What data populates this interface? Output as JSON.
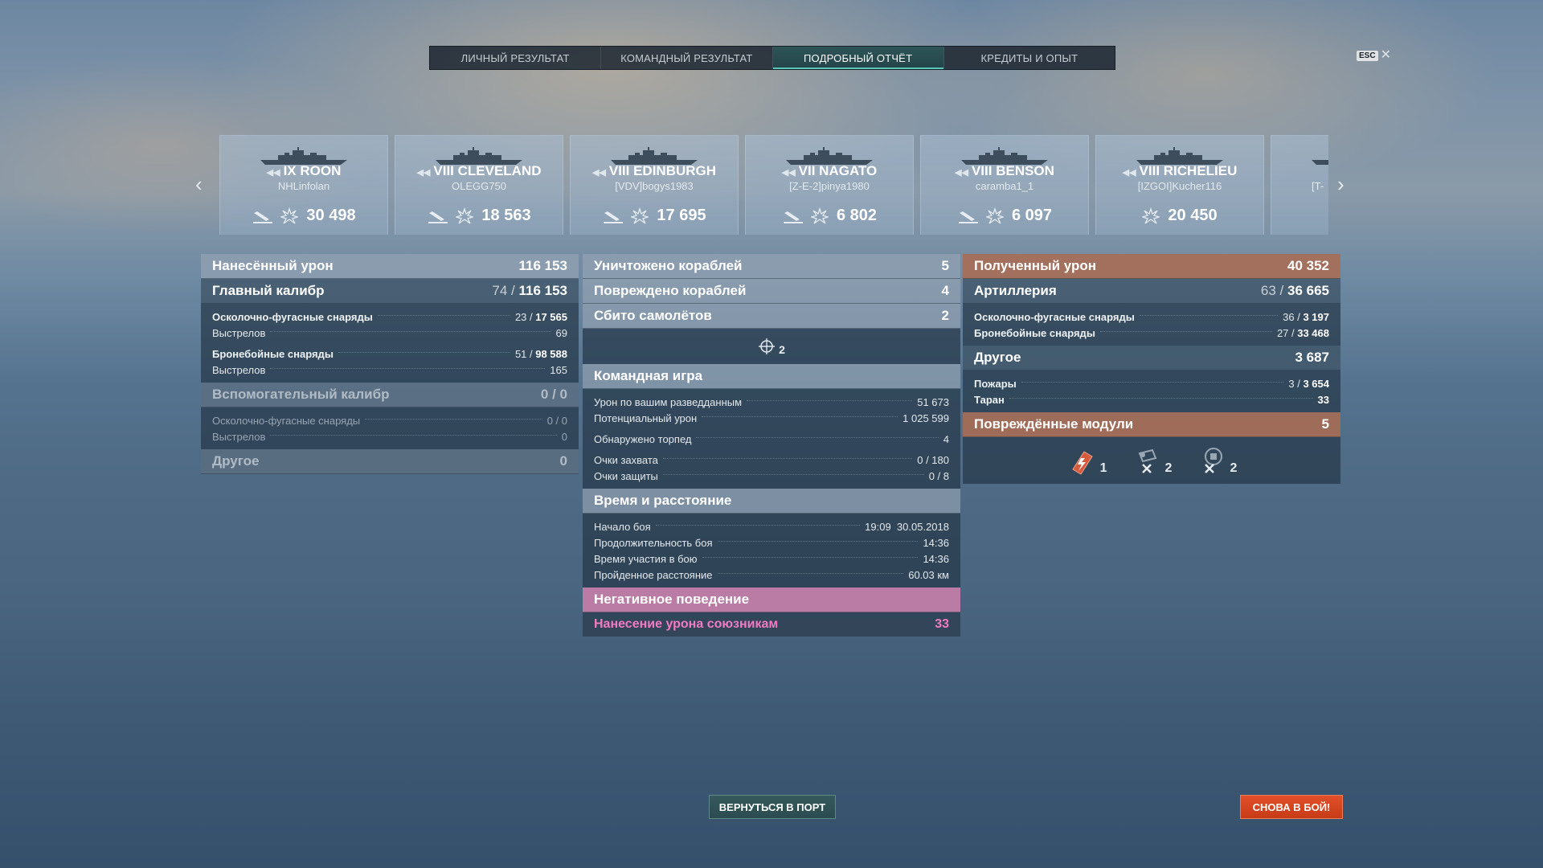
{
  "tabs": [
    {
      "label": "ЛИЧНЫЙ РЕЗУЛЬТАТ"
    },
    {
      "label": "КОМАНДНЫЙ РЕЗУЛЬТАТ"
    },
    {
      "label": "ПОДРОБНЫЙ ОТЧЁТ"
    },
    {
      "label": "КРЕДИТЫ И ОПЫТ"
    }
  ],
  "active_tab": "ПОДРОБНЫЙ ОТЧЁТ",
  "esc_label": "ESC",
  "ships": [
    {
      "name": "IX ROON",
      "player": "NHLinfolan",
      "damage": "30 498"
    },
    {
      "name": "VIII CLEVELAND",
      "player": "OLEGG750",
      "damage": "18 563"
    },
    {
      "name": "VIII EDINBURGH",
      "player": "[VDV]bogys1983",
      "damage": "17 695"
    },
    {
      "name": "VII NAGATO",
      "player": "[Z-E-2]pinya1980",
      "damage": "6 802"
    },
    {
      "name": "VIII BENSON",
      "player": "caramba1_1",
      "damage": "6 097"
    },
    {
      "name": "VIII RICHELIEU",
      "player": "[IZGOI]Kucher116",
      "damage": "20 450"
    },
    {
      "player_partial": "[T-"
    }
  ],
  "left": {
    "dealt_damage": {
      "label": "Нанесённый урон",
      "value": "116 153"
    },
    "main_battery": {
      "label": "Главный калибр",
      "hits": "74 / ",
      "value": "116 153"
    },
    "he_shells": {
      "label": "Осколочно-фугасные снаряды",
      "hits": "23 / ",
      "value": "17 565"
    },
    "he_shots": {
      "label": "Выстрелов",
      "value": "69"
    },
    "ap_shells": {
      "label": "Бронебойные снаряды",
      "hits": "51 / ",
      "value": "98 588"
    },
    "ap_shots": {
      "label": "Выстрелов",
      "value": "165"
    },
    "secondary": {
      "label": "Вспомогательный калибр",
      "value": "0 / 0"
    },
    "sec_he": {
      "label": "Осколочно-фугасные снаряды",
      "value": "0 / 0"
    },
    "sec_shots": {
      "label": "Выстрелов",
      "value": "0"
    },
    "other": {
      "label": "Другое",
      "value": "0"
    }
  },
  "middle": {
    "destroyed": {
      "label": "Уничтожено кораблей",
      "value": "5"
    },
    "damaged": {
      "label": "Повреждено кораблей",
      "value": "4"
    },
    "planes": {
      "label": "Сбито самолётов",
      "value": "2"
    },
    "planes_icon_count": "2",
    "team_play": {
      "label": "Командная игра"
    },
    "spotting": {
      "label": "Урон по вашим разведданным",
      "value": "51 673"
    },
    "potential": {
      "label": "Потенциальный урон",
      "value": "1 025 599"
    },
    "torps": {
      "label": "Обнаружено торпед",
      "value": "4"
    },
    "capture": {
      "label": "Очки захвата",
      "value": "0 / 180"
    },
    "defense": {
      "label": "Очки защиты",
      "value": "0 / 8"
    },
    "time_distance": {
      "label": "Время и расстояние"
    },
    "battle_start": {
      "label": "Начало боя",
      "value": "19:09  30.05.2018"
    },
    "duration": {
      "label": "Продолжительность боя",
      "value": "14:36"
    },
    "participation": {
      "label": "Время участия в бою",
      "value": "14:36"
    },
    "distance": {
      "label": "Пройденное расстояние",
      "value": "60.03 км"
    },
    "negative": {
      "label": "Негативное поведение"
    },
    "team_damage": {
      "label": "Нанесение урона союзникам",
      "value": "33"
    }
  },
  "right": {
    "received": {
      "label": "Полученный урон",
      "value": "40 352"
    },
    "artillery": {
      "label": "Артиллерия",
      "hits": "63 / ",
      "value": "36 665"
    },
    "he_shells": {
      "label": "Осколочно-фугасные снаряды",
      "hits": "36 / ",
      "value": "3 197"
    },
    "ap_shells": {
      "label": "Бронебойные снаряды",
      "hits": "27 / ",
      "value": "33 468"
    },
    "other": {
      "label": "Другое",
      "value": "3 687"
    },
    "fires": {
      "label": "Пожары",
      "hits": "3 / ",
      "value": "3 654"
    },
    "ram": {
      "label": "Таран",
      "value": "33"
    },
    "modules": {
      "label": "Повреждённые модули",
      "value": "5"
    },
    "module_counts": [
      "1",
      "2",
      "2"
    ]
  },
  "buttons": {
    "port": "ВЕРНУТЬСЯ В ПОРТ",
    "battle": "СНОВА В БОЙ!"
  },
  "colors": {
    "accent_teal": "#58c7b5",
    "received_orange": "#a86c52",
    "negative_pink": "#f27bc2",
    "battle_button": "#d9441f"
  }
}
